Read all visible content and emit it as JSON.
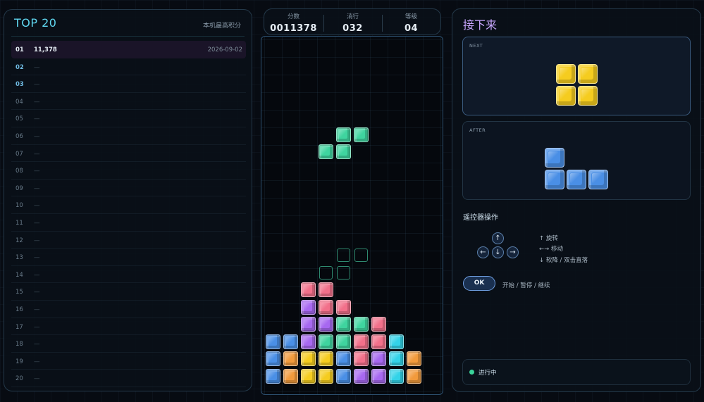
{
  "leaderboard": {
    "title": "TOP 20",
    "subtitle": "本机最高积分",
    "entries": [
      {
        "rank": "01",
        "score": "11,378",
        "date": "2026-09-02"
      },
      {
        "rank": "02",
        "score": "—",
        "date": ""
      },
      {
        "rank": "03",
        "score": "—",
        "date": ""
      },
      {
        "rank": "04",
        "score": "—",
        "date": ""
      },
      {
        "rank": "05",
        "score": "—",
        "date": ""
      },
      {
        "rank": "06",
        "score": "—",
        "date": ""
      },
      {
        "rank": "07",
        "score": "—",
        "date": ""
      },
      {
        "rank": "08",
        "score": "—",
        "date": ""
      },
      {
        "rank": "09",
        "score": "—",
        "date": ""
      },
      {
        "rank": "10",
        "score": "—",
        "date": ""
      },
      {
        "rank": "11",
        "score": "—",
        "date": ""
      },
      {
        "rank": "12",
        "score": "—",
        "date": ""
      },
      {
        "rank": "13",
        "score": "—",
        "date": ""
      },
      {
        "rank": "14",
        "score": "—",
        "date": ""
      },
      {
        "rank": "15",
        "score": "—",
        "date": ""
      },
      {
        "rank": "16",
        "score": "—",
        "date": ""
      },
      {
        "rank": "17",
        "score": "—",
        "date": ""
      },
      {
        "rank": "18",
        "score": "—",
        "date": ""
      },
      {
        "rank": "19",
        "score": "—",
        "date": ""
      },
      {
        "rank": "20",
        "score": "—",
        "date": ""
      }
    ]
  },
  "stats": {
    "score_label": "分数",
    "score": "0011378",
    "lines_label": "消行",
    "lines": "032",
    "level_label": "等级",
    "level": "04"
  },
  "colors": {
    "blue": "#4a8fe6",
    "orange": "#f29a3c",
    "yellow": "#f5cc1f",
    "green": "#3fd49f",
    "purple": "#a768f0",
    "pink": "#f2708a",
    "cyan": "#33d3e8"
  },
  "board": {
    "columns": 10,
    "rows": 20,
    "active_piece": {
      "color": "green",
      "cells": [
        [
          4,
          5
        ],
        [
          5,
          5
        ],
        [
          3,
          6
        ],
        [
          4,
          6
        ]
      ]
    },
    "ghost_piece": {
      "cells": [
        [
          4,
          12
        ],
        [
          5,
          12
        ],
        [
          3,
          13
        ],
        [
          4,
          13
        ]
      ]
    },
    "locked": [
      {
        "row": 14,
        "cells": {
          "2": "pink",
          "3": "pink"
        }
      },
      {
        "row": 15,
        "cells": {
          "2": "purple",
          "3": "pink",
          "4": "pink"
        }
      },
      {
        "row": 16,
        "cells": {
          "2": "purple",
          "3": "purple",
          "4": "green",
          "5": "green",
          "6": "pink"
        }
      },
      {
        "row": 17,
        "cells": {
          "0": "blue",
          "1": "blue",
          "2": "purple",
          "3": "green",
          "4": "green",
          "5": "pink",
          "6": "pink",
          "7": "cyan"
        }
      },
      {
        "row": 18,
        "cells": {
          "0": "blue",
          "1": "orange",
          "2": "yellow",
          "3": "yellow",
          "4": "blue",
          "5": "pink",
          "6": "purple",
          "7": "cyan",
          "8": "orange"
        }
      },
      {
        "row": 19,
        "cells": {
          "0": "blue",
          "1": "orange",
          "2": "yellow",
          "3": "yellow",
          "4": "blue",
          "5": "purple",
          "6": "purple",
          "7": "cyan",
          "8": "orange"
        }
      }
    ]
  },
  "upcoming": {
    "title": "接下来",
    "next_label": "NEXT",
    "next_piece": {
      "name": "O",
      "color": "yellow",
      "cells": [
        [
          0,
          0
        ],
        [
          1,
          0
        ],
        [
          0,
          1
        ],
        [
          1,
          1
        ]
      ]
    },
    "after_label": "AFTER",
    "after_piece": {
      "name": "J",
      "color": "blue",
      "cells": [
        [
          0,
          0
        ],
        [
          0,
          1
        ],
        [
          1,
          1
        ],
        [
          2,
          1
        ]
      ]
    }
  },
  "controls": {
    "title": "遥控器操作",
    "keys": {
      "up": "↑",
      "left": "←",
      "down": "↓",
      "right": "→"
    },
    "hint_rotate": "↑ 旋转",
    "hint_move": "←→ 移动",
    "hint_drop": "↓ 软降 / 双击直落",
    "ok_label": "OK",
    "ok_hint": "开始 / 暂停 / 继续"
  },
  "status": {
    "text": "进行中"
  }
}
